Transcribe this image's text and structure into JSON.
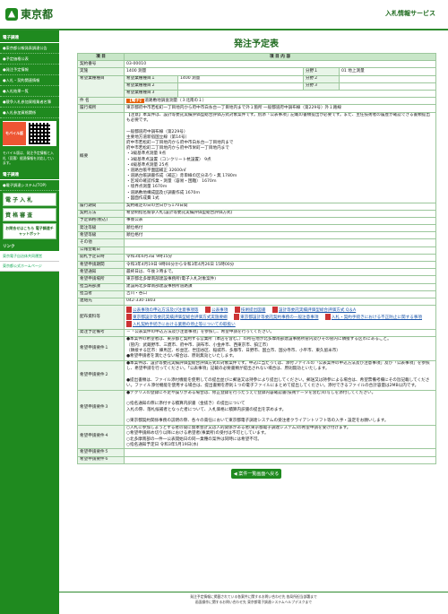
{
  "header": {
    "logo_text": "東京都",
    "site_title": "入札情報サービス"
  },
  "sidebar": {
    "head1": "電子調達",
    "items": [
      "●東京都公報発表調達公告",
      "●予定価格公表",
      "●発注予定情報",
      "●入札・契約関連情報",
      "●入札結果一覧",
      "●競争入札参加資格業者名簿",
      "●入札参加資格関係"
    ],
    "mobile_label": "モバイル版",
    "mobile_note": "モバイル版は、発注予定情報と入札（見積）経過情報を対応しています。",
    "head2": "電子調達",
    "item_sys": "●電子調達システム(TOP)",
    "big1": "電 子 入 札",
    "big2": "資 格 審 査",
    "info": "お問合せはこちら 電子調達チャットボット",
    "head3": "リンク",
    "links": [
      "東京電子自治体共同運営",
      "東京都公式ホームページ"
    ]
  },
  "main": {
    "title": "発注予定表",
    "col_item": "項 目",
    "col_content": "項 目 内 容",
    "rows": {
      "contract_no": {
        "label": "契約番号",
        "value": "03-00010"
      },
      "business": {
        "label": "実施",
        "value": "1400 測量"
      },
      "bunya_label": "分野１",
      "bunya1": "01 地上測量",
      "bunya2": "分野２",
      "bunya3": "分野３",
      "gyomu_label": "希望業種種目",
      "gyomu1": "希望業種種目１",
      "gyomu1_val": "1400 測量",
      "gyomu2": "希望業種種目２",
      "gyomu3": "希望業種種目３",
      "kenmei_label": "件 名",
      "kenmei_tag": "【電子】",
      "kenmei": "道路敷地調査測量（３北南の１）",
      "place_label": "履行場所",
      "place": "東京都府中市若松町一丁目地内から府中市白糸台一丁目地内まで外１箇所 一般都道府中調布線（第229号）外１路線",
      "gaiyo_label": "概要",
      "gaiyo": "【注意】本案件は、設計等委託実績評価型総合評価方式対象案件です。別添「公表事項」記載の書類提出が必要です。また、主任技術者の履歴が確認できる書類提出も必要です。\n\n一般都道府中調布線（第229号）\n主要地方道新宿国立線（第14号）\n府中市若松町一丁目地内から府中市白糸台一丁目地内まで\n府中市若松町二丁目地内から府中市栄町一丁目地内まで\n・3級基準点測量 9点\n・3級基準点設置（コンクリート杭設置） 9点\n・4級基準点測量 25点\n・道路台帳平面図補正 32600㎡\n・道路台帳調書作成（補正）赤単線の区分あり・無 1780ｍ\n・区域の確認作業・測量（容易・困難） 1670ｍ\n・境界点測量 1670ｍ\n・道路敷地構成図及び調書作成 1670ｍ\n・図面作成費 1式",
      "period_label": "履行期間",
      "period": "契約確定の日の翌日から170日間",
      "method_label": "契約方法",
      "method": "希望制指名競争入札(設計等委託実績評価型総合評価方式)",
      "tax_label": "予定価格(税込)",
      "tax": "事後公表",
      "dept_label": "発注等級",
      "dept": "順位格付",
      "rank_label": "希望等級",
      "rank": "順位格付",
      "other_label": "その他",
      "other": "",
      "date_label": "公報登載日",
      "date": "",
      "open_label": "開札予定日時",
      "open": "令和3年6月3日 9時15分",
      "want_label": "希望申請期間",
      "want": "令和3年4月19日 9時00分から令和3年4月26日 15時00分",
      "deadline_label": "希望通知",
      "deadline": "最終日は、午後３時まで。",
      "office_label": "希望申請場所",
      "office": "東京都北多摩南部建設事務所(電子入札対象案件)",
      "jimusho_label": "担当局部課",
      "jimusho": "建設局北多摩南部建設事務所道路課",
      "person_label": "担当者",
      "person": "吉川・谷口",
      "tel_label": "連絡先",
      "tel": "042-330-1803",
      "docs_label": "配布資料等",
      "docs": [
        "公表事項の申込方法及び注意事項等",
        "公表事項",
        "技術提出図書",
        "設計等委託実績評価型総合評価方式 Q＆A",
        "東京都設計等委託実績評価型総合評価方式実施要綱",
        "東京都設計等委託契約事務の一般注意事項",
        "入札・契約手続きにおける不正防止に関する事項",
        "入札契約手続きにおける業務の停止等についての取扱い"
      ],
      "appeal_label": "発注予定備考",
      "appeal": "－「公表案件の申込方法及び注意事項」を参照し、希望申請を行ってください。",
      "req1_label": "希望申請要件１",
      "req1": "●本案件の希望者は、東京都と契約する営業所（本店を含む。）の所在地が北多摩南部建設事務所管内及びその管内に隣接する区市にあること。\n（管内：武蔵野市、三鷹市、府中市、調布市、小金井市、西東京市、狛江市）\n（隣接する区市：練馬区、杉並区、世田谷区、稲城市、多摩市、日野市、国立市、国分寺市、小平市、東久留米市）\n●希望申請者を満たさない場合は、原則無効といたします。",
      "req2_label": "希望申請要件２",
      "req2": "●本案件は、設計等委託実績評価型総合評価方式の対象案件です。申込に当たっては、添付ファイルの「公表案件の申込方法及び注意事項」及び「公表事項」を参照し、希望申請を行ってください。「公表事項」記載の必要書類が提出されない場合は、原則無効といたします。\n\n●提出書類は、ファイル添付機能を使用しての提出並びに郵送又は持参により提出してください。郵送又は持参による場合は、希望票備考欄にその旨記載してください。ファイル添付機能を使用する場合は、提出書類を原則１つの電子ファイルにまとめて提出してください。添付できるファイルの合計容量は2MB以内です。",
      "req3_label": "希望申請要件３",
      "req3": "●テクリスの登録に不足や誤りがある場合は、修正登録を行ったうえで登録内容確認書(技術データを含む)の写しを添付してください。\n\n○指名通知の際に添付する積算内訳書（金抜き）の提出について\n入札の際、落札候補者となった者について、入札価格に積算内訳書の提出を求めます。\n\n○東京都契約関係事務の説明の際、各々の責任において東京都電子調達システムの受注者クライアントソフト等の入手・設定をお願いします。",
      "req4_label": "希望申請要件４",
      "req4": "○入札に参加しようとする者の間に資本会計又は人的関係がある者(東京都電子調達システム)の希望申請を受け付けます。\n○希望申請締め切り以降における希望者(事業所)の受付は不可としています。\n○北多摩南部の一件一公表開始日の同一業種の案件は同時には希望不可。\n○指名通知予定日 令和3年5月19日(水)",
      "req5_label": "希望申請要件５",
      "req6_label": "希望申請要件６"
    },
    "back_button": "案件一覧画面へ戻る"
  },
  "footer": {
    "line1": "発注予定情報に掲載されている各案件に関するお問い合わせ先 各局所担当部署まで",
    "line2": "画面操作に関するお問い合わせ先 東京都電子調達システムヘルプデスクまで"
  }
}
